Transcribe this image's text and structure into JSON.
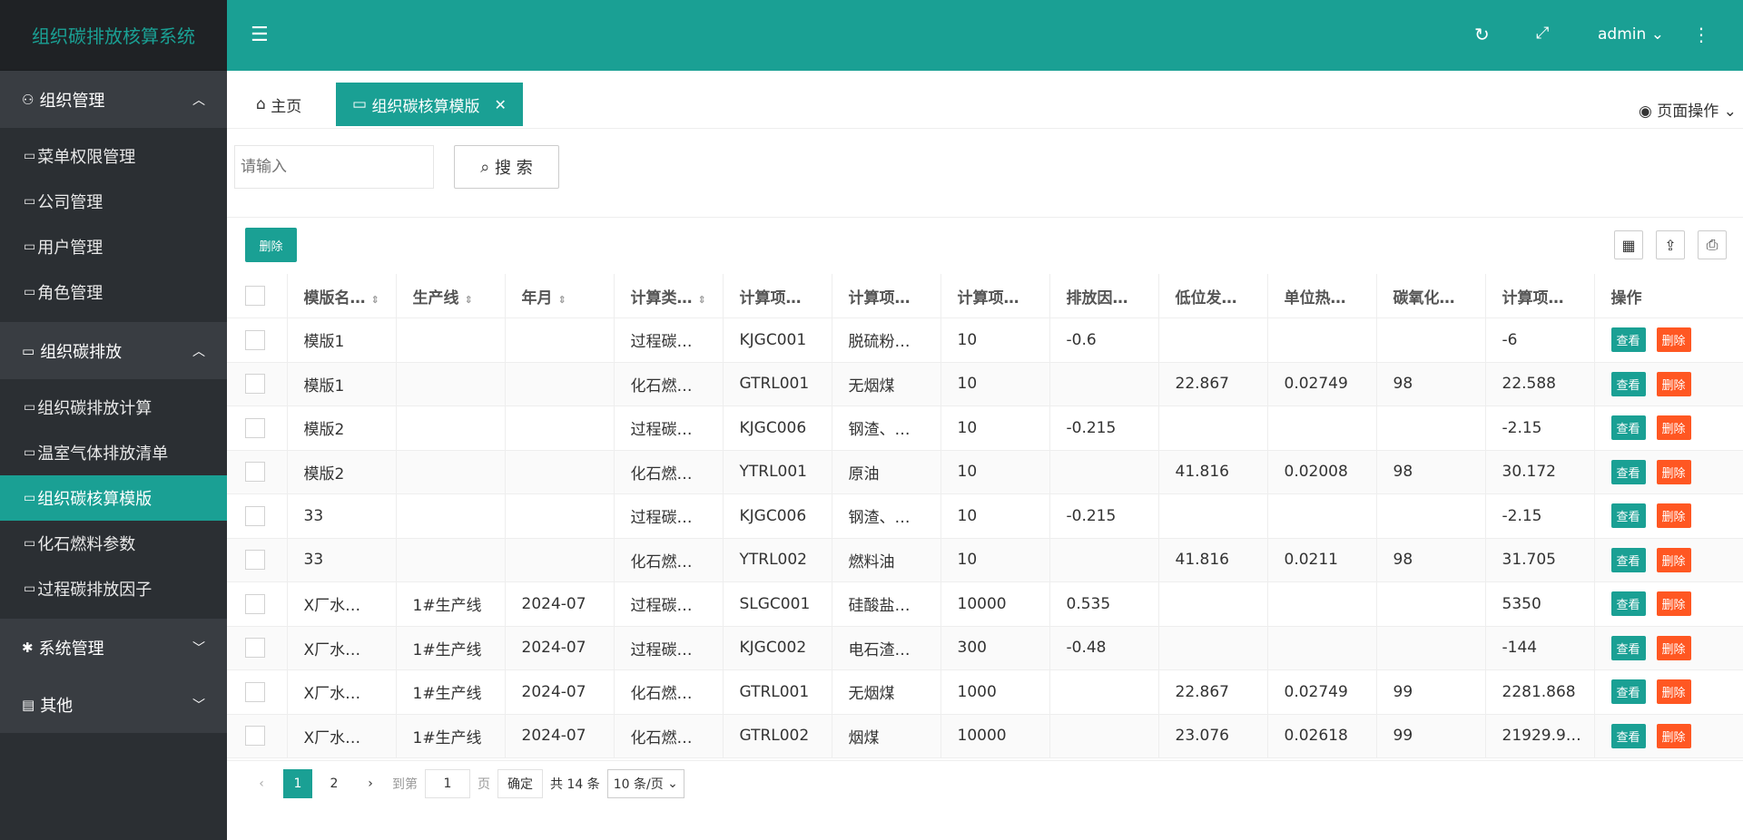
{
  "app": {
    "title": "组织碳排放核算系统"
  },
  "sidebar": {
    "groups": [
      {
        "label": "组织管理",
        "items": [
          "菜单权限管理",
          "公司管理",
          "用户管理",
          "角色管理"
        ]
      },
      {
        "label": "组织碳排放",
        "items": [
          "组织碳排放计算",
          "温室气体排放清单",
          "组织碳核算模版",
          "化石燃料参数",
          "过程碳排放因子"
        ]
      },
      {
        "label": "系统管理"
      },
      {
        "label": "其他"
      }
    ]
  },
  "header": {
    "user": "admin"
  },
  "tabs": {
    "home": "主页",
    "current": "组织碳核算模版",
    "page_ops": "页面操作"
  },
  "search": {
    "placeholder": "请输入",
    "button": "搜 索"
  },
  "toolbar": {
    "delete": "删除"
  },
  "table": {
    "columns": [
      "模版名…",
      "生产线",
      "年月",
      "计算类…",
      "计算项…",
      "计算项…",
      "计算项…",
      "排放因…",
      "低位发…",
      "单位热…",
      "碳氧化…",
      "计算项…",
      "操作"
    ],
    "view": "查看",
    "del": "删除",
    "rows": [
      [
        "模版1",
        "",
        "",
        "过程碳…",
        "KJGC001",
        "脱硫粉…",
        "10",
        "-0.6",
        "",
        "",
        "",
        "-6"
      ],
      [
        "模版1",
        "",
        "",
        "化石燃…",
        "GTRL001",
        "无烟煤",
        "10",
        "",
        "22.867",
        "0.02749",
        "98",
        "22.588"
      ],
      [
        "模版2",
        "",
        "",
        "过程碳…",
        "KJGC006",
        "钢渣、…",
        "10",
        "-0.215",
        "",
        "",
        "",
        "-2.15"
      ],
      [
        "模版2",
        "",
        "",
        "化石燃…",
        "YTRL001",
        "原油",
        "10",
        "",
        "41.816",
        "0.02008",
        "98",
        "30.172"
      ],
      [
        "33",
        "",
        "",
        "过程碳…",
        "KJGC006",
        "钢渣、…",
        "10",
        "-0.215",
        "",
        "",
        "",
        "-2.15"
      ],
      [
        "33",
        "",
        "",
        "化石燃…",
        "YTRL002",
        "燃料油",
        "10",
        "",
        "41.816",
        "0.0211",
        "98",
        "31.705"
      ],
      [
        "X厂水…",
        "1#生产线",
        "2024-07",
        "过程碳…",
        "SLGC001",
        "硅酸盐…",
        "10000",
        "0.535",
        "",
        "",
        "",
        "5350"
      ],
      [
        "X厂水…",
        "1#生产线",
        "2024-07",
        "过程碳…",
        "KJGC002",
        "电石渣…",
        "300",
        "-0.48",
        "",
        "",
        "",
        "-144"
      ],
      [
        "X厂水…",
        "1#生产线",
        "2024-07",
        "化石燃…",
        "GTRL001",
        "无烟煤",
        "1000",
        "",
        "22.867",
        "0.02749",
        "99",
        "2281.868"
      ],
      [
        "X厂水…",
        "1#生产线",
        "2024-07",
        "化石燃…",
        "GTRL002",
        "烟煤",
        "10000",
        "",
        "23.076",
        "0.02618",
        "99",
        "21929.9…"
      ]
    ]
  },
  "pager": {
    "pages": [
      "1",
      "2"
    ],
    "goto_label": "到第",
    "goto_value": "1",
    "page_label": "页",
    "confirm": "确定",
    "total": "共 14 条",
    "per_page": "10 条/页"
  }
}
